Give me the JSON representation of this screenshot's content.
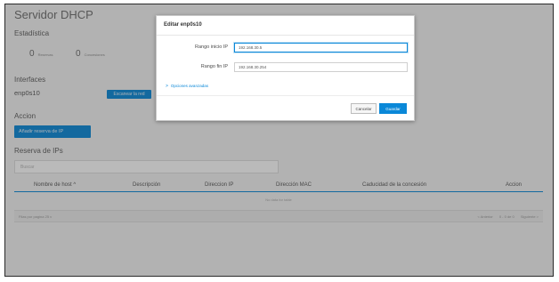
{
  "page": {
    "title": "Servidor DHCP",
    "stats_heading": "Estadística",
    "stats": [
      {
        "value": "0",
        "label": "Reservas"
      },
      {
        "value": "0",
        "label": "Concesiones"
      }
    ],
    "interfaces_heading": "Interfaces",
    "interface_name": "enp0s10",
    "scan_button": "Escanear la red",
    "action_heading": "Accion",
    "add_reservation_button": "Añadir reserva de IP",
    "reservations_heading": "Reserva de IPs",
    "search_placeholder": "Buscar",
    "table": {
      "columns": [
        "Nombre de host ^",
        "Descripción",
        "Direccion IP",
        "Dirección MAC",
        "Caducidad de la concesión",
        "Accion"
      ],
      "empty_text": "No data for table"
    },
    "pager": {
      "rows_label": "Filas por pagina",
      "rows_value": "25",
      "rows_caret": "v",
      "prev": "< Anterior",
      "range": "0 - 0 de 0",
      "next": "Siguiente >"
    }
  },
  "modal": {
    "title": "Editar enp0s10",
    "fields": [
      {
        "label": "Rango inicio IP",
        "value": "192.168.30.5"
      },
      {
        "label": "Rango fin IP",
        "value": "192.168.30.254"
      }
    ],
    "advanced_chevron": ">",
    "advanced_label": "Opciones avanzadas",
    "cancel": "Cancelar",
    "save": "Guardar"
  }
}
